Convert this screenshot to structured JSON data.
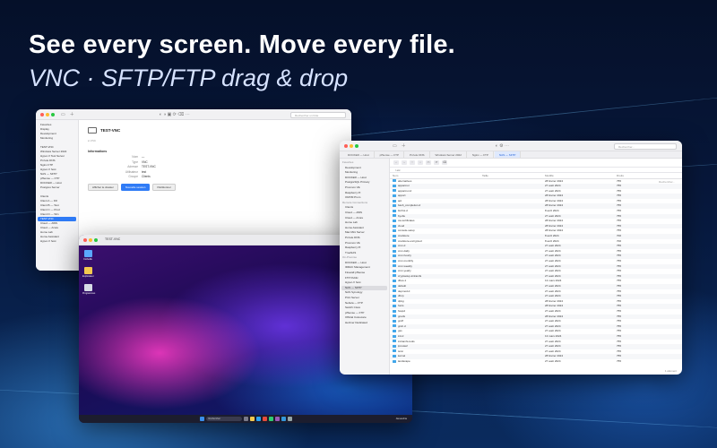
{
  "headline": "See every screen. Move every file.",
  "subline": "VNC · SFTP/FTP drag & drop",
  "vnc_window": {
    "search_placeholder": "Rechercher un hôte",
    "sidebar": [
      "Favorites",
      "Display",
      "Development",
      "Monitoring",
      "",
      "TEST-VNC",
      "Windows Server 2022",
      "Hyper-V Test Server",
      "Pi-hole DNS",
      "Nginx FTP",
      "Hyper-V host",
      "NAS — SFTP",
      "pfSense — FTP",
      "DOCKER — Host",
      "Postgres Server",
      "",
      "Clients",
      "Client A — FR",
      "Client B — Test",
      "Client C — Prod",
      "Client D — Win",
      "TEST-VNC",
      "Cloud — AWS",
      "Cloud — Azure",
      "Home Lab",
      "Home Assistant",
      "Hyper-V host"
    ],
    "host_title": "TEST-VNC",
    "section": "Informations",
    "info": [
      {
        "k": "Nom",
        "v": "—"
      },
      {
        "k": "Type",
        "v": "VNC"
      },
      {
        "k": "Adresse",
        "v": "TEST-VNC"
      },
      {
        "k": "Utilisateur",
        "v": "test"
      },
      {
        "k": "Groupe",
        "v": "Clients"
      }
    ],
    "buttons": [
      "Afficher le dossier",
      "Nouvelle session",
      "Partitionner"
    ]
  },
  "remote_desktop": {
    "title": "TEST-VNC",
    "icons": [
      "Corbeille",
      "Explorateur",
      "Programmes"
    ],
    "search": "Rechercher",
    "clock": "Alexandria"
  },
  "sftp_window": {
    "search_placeholder": "Rechercher...",
    "search_local": "Rechercher...",
    "tabs": [
      "DOCKER — Host",
      "pfSense — FTP",
      "Pi-hole DNS",
      "Windows Server 2022",
      "Nginx — FTP",
      "NAS — SFTP"
    ],
    "path": "/ etc",
    "sidebar": [
      "Favorites",
      "Development",
      "Monitoring",
      "DOCKER — Host",
      "PostgreSQL Primary",
      "Proxmox VE",
      "Raspberry Pi",
      "OMVM Prom",
      "Remote Connections",
      "Clients",
      "Cloud — AWS",
      "Cloud — Azure",
      "Home Lab",
      "Home Assistant",
      "Mac Mini Server",
      "Pi-hole DNS",
      "Proxmox VE",
      "Raspberry Pi",
      "TrueNAS",
      "On-Premise",
      "DOCKER — Host",
      "IDRAC Management",
      "Firewall pfSense",
      "FTP Public",
      "Hyper-V host",
      "NAS — SFTP",
      "NAS Synology",
      "Print Server",
      "Nebula — FTP",
      "Switch Cisco",
      "pfSense — FTP",
      "Official Coloocare",
      "Hetzner Dedicated"
    ],
    "columns": [
      "Nom",
      "Taille",
      "Modifié",
      "Droits"
    ],
    "rows": [
      [
        "alternatives",
        "",
        "28 février 2024",
        "755"
      ],
      [
        "apparmor",
        "",
        "27 août 2024",
        "755"
      ],
      [
        "apparmor.d",
        "",
        "27 août 2024",
        "755"
      ],
      [
        "apport",
        "",
        "28 février 2024",
        "755"
      ],
      [
        "apt",
        "",
        "28 février 2024",
        "755"
      ],
      [
        "bash_completion.d",
        "",
        "28 février 2024",
        "755"
      ],
      [
        "binfmt.d",
        "",
        "8 avril 2024",
        "755"
      ],
      [
        "byobu",
        "",
        "27 août 2024",
        "755"
      ],
      [
        "ca-certificates",
        "",
        "28 février 2024",
        "755"
      ],
      [
        "cloud",
        "",
        "28 février 2024",
        "755"
      ],
      [
        "console-setup",
        "",
        "28 février 2024",
        "755"
      ],
      [
        "credstore",
        "",
        "8 avril 2024",
        "700"
      ],
      [
        "credstore.encrypted",
        "",
        "8 avril 2024",
        "700"
      ],
      [
        "cron.d",
        "",
        "27 août 2024",
        "755"
      ],
      [
        "cron.daily",
        "",
        "27 août 2024",
        "755"
      ],
      [
        "cron.hourly",
        "",
        "27 août 2024",
        "755"
      ],
      [
        "cron.monthly",
        "",
        "27 août 2024",
        "755"
      ],
      [
        "cron.weekly",
        "",
        "27 août 2024",
        "755"
      ],
      [
        "cron.yearly",
        "",
        "27 août 2024",
        "755"
      ],
      [
        "cryptsetup-initramfs",
        "",
        "27 août 2024",
        "755"
      ],
      [
        "dbus-1",
        "",
        "13 mars 2024",
        "755"
      ],
      [
        "default",
        "",
        "27 août 2024",
        "755"
      ],
      [
        "depmod.d",
        "",
        "27 août 2024",
        "755"
      ],
      [
        "dhcp",
        "",
        "27 août 2024",
        "755"
      ],
      [
        "dpkg",
        "",
        "28 février 2024",
        "755"
      ],
      [
        "fonts",
        "",
        "28 février 2024",
        "755"
      ],
      [
        "fwupd",
        "",
        "27 août 2024",
        "755"
      ],
      [
        "gnutls",
        "",
        "28 février 2024",
        "755"
      ],
      [
        "groff",
        "",
        "27 août 2024",
        "755"
      ],
      [
        "grub.d",
        "",
        "27 août 2024",
        "755"
      ],
      [
        "gss",
        "",
        "27 août 2024",
        "755"
      ],
      [
        "init.d",
        "",
        "13 mars 2024",
        "755"
      ],
      [
        "initramfs-tools",
        "",
        "27 août 2024",
        "755"
      ],
      [
        "iproute2",
        "",
        "27 août 2024",
        "755"
      ],
      [
        "iscsi",
        "",
        "27 août 2024",
        "755"
      ],
      [
        "kernel",
        "",
        "28 février 2024",
        "755"
      ],
      [
        "landscape",
        "",
        "27 août 2024",
        "755"
      ]
    ],
    "footer": "1 élément"
  }
}
